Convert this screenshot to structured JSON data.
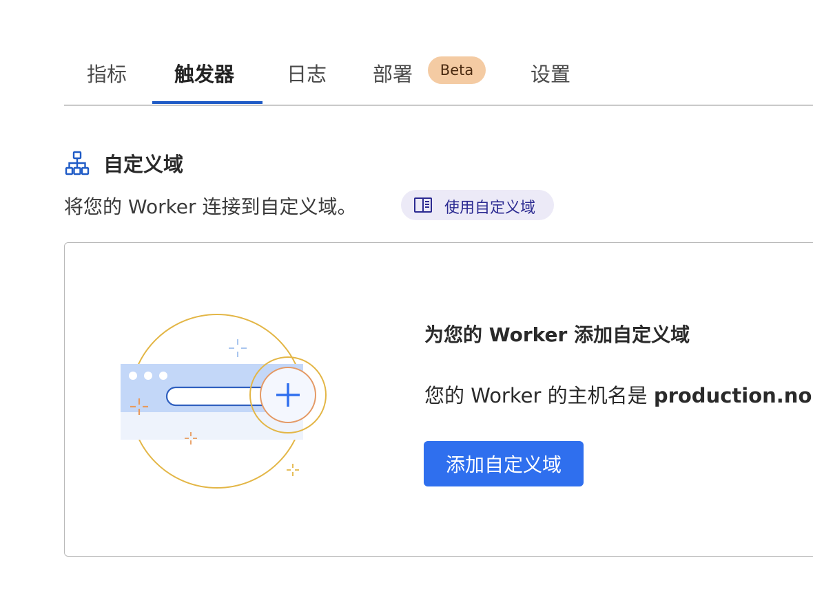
{
  "tabs": [
    {
      "label": "指标"
    },
    {
      "label": "触发器"
    },
    {
      "label": "日志"
    },
    {
      "label": "部署",
      "badge": "Beta"
    },
    {
      "label": "设置"
    }
  ],
  "active_tab": "触发器",
  "section": {
    "icon": "sitemap-icon",
    "title": "自定义域",
    "description": "将您的 Worker 连接到自定义域。",
    "doc_link": {
      "icon": "book-icon",
      "label": "使用自定义域"
    }
  },
  "empty_state": {
    "illustration": "browser-add-domain-illustration",
    "title": "为您的 Worker 添加自定义域",
    "text_prefix": "您的 Worker 的主机名是 ",
    "hostname": "production.no",
    "button_label": "添加自定义域"
  },
  "colors": {
    "accent": "#2f6fee",
    "tab_underline": "#1f5bc6",
    "badge_bg": "#f4cba3",
    "doc_pill_bg": "#eceaf7",
    "doc_pill_text": "#2b2a91"
  }
}
